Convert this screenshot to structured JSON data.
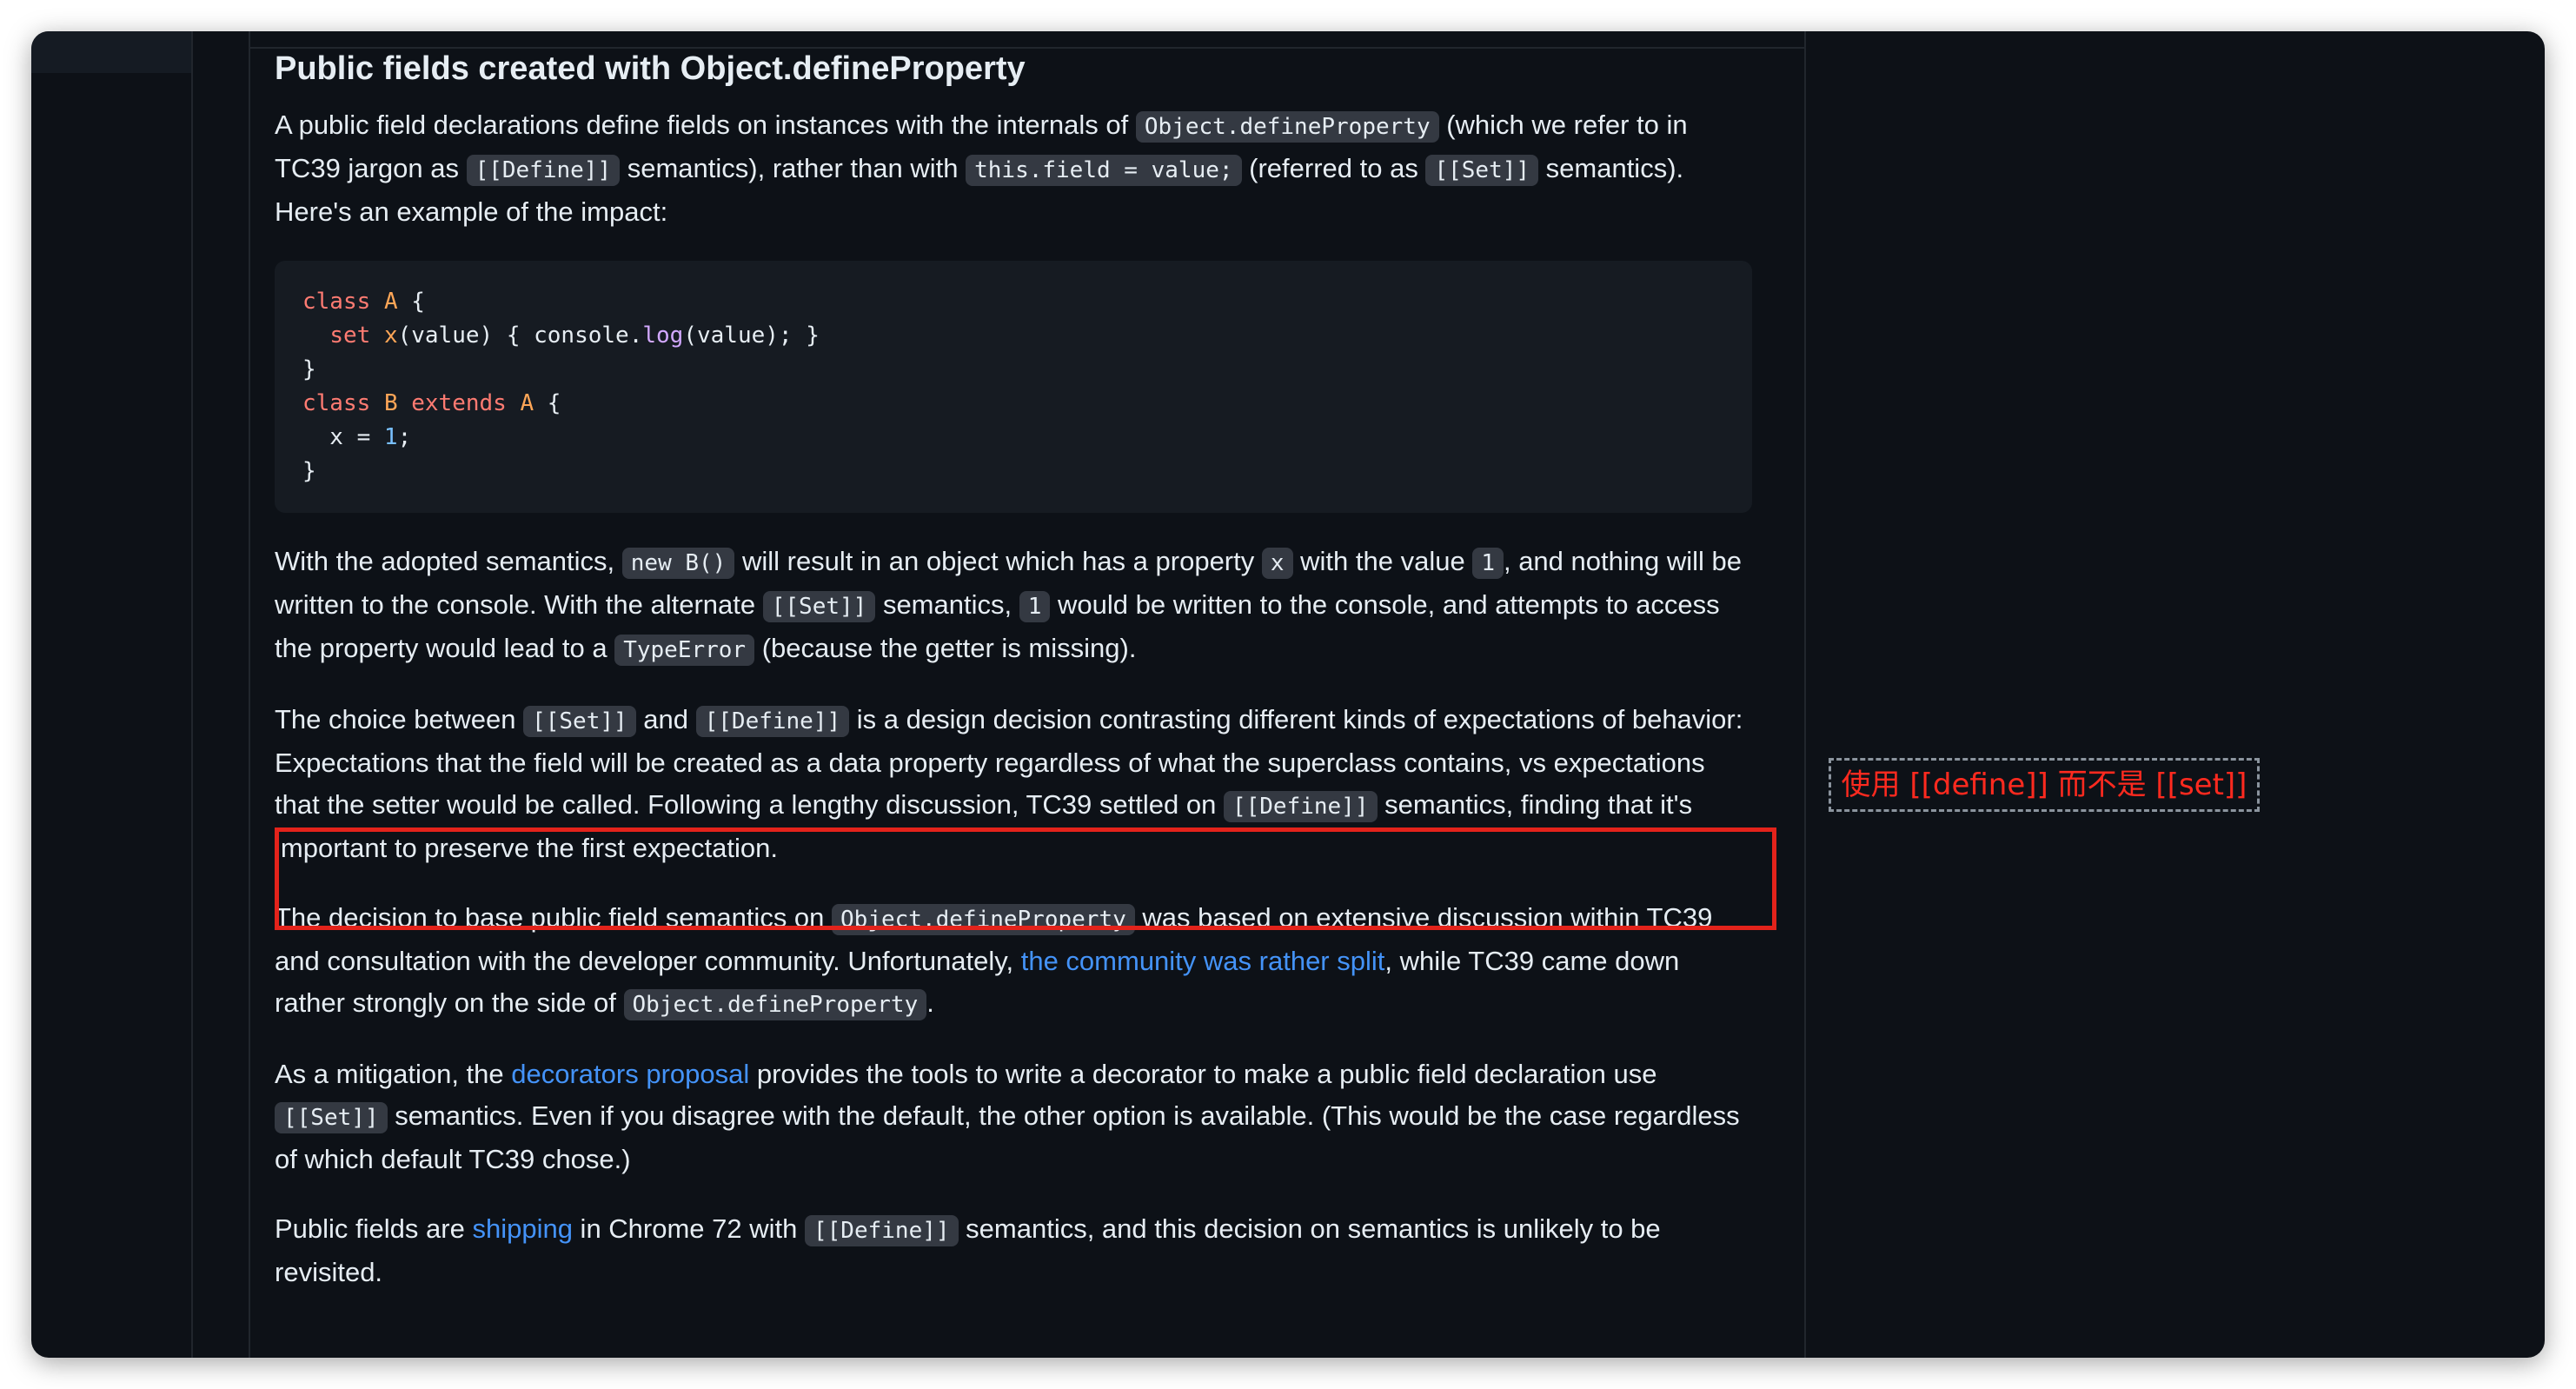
{
  "article": {
    "heading": "Public fields created with Object.defineProperty",
    "p1": {
      "t1": "A public field declarations define fields on instances with the internals of ",
      "c1": "Object.defineProperty",
      "t2": " (which we refer to in TC39 jargon as ",
      "c2": "[[Define]]",
      "t3": " semantics), rather than with ",
      "c3": "this.field = value;",
      "t4": " (referred to as ",
      "c4": "[[Set]]",
      "t5": " semantics). Here's an example of the impact:"
    },
    "code": {
      "l1": [
        "class",
        " ",
        "A",
        " {"
      ],
      "l2": [
        "  ",
        "set",
        " ",
        "x",
        "(value) { console.",
        "log",
        "(value); }"
      ],
      "l3": "}",
      "l4": [
        "class",
        " ",
        "B",
        " ",
        "extends",
        " ",
        "A",
        " {"
      ],
      "l5": [
        "  x = ",
        "1",
        ";"
      ],
      "l6": "}"
    },
    "p2": {
      "t1": "With the adopted semantics, ",
      "c1": "new B()",
      "t2": " will result in an object which has a property ",
      "c2": "x",
      "t3": " with the value ",
      "c3": "1",
      "t4": ", and nothing will be written to the console. With the alternate ",
      "c4": "[[Set]]",
      "t5": " semantics, ",
      "c5": "1",
      "t6": " would be written to the console, and attempts to access the property would lead to a ",
      "c6": "TypeError",
      "t7": " (because the getter is missing)."
    },
    "p3": {
      "t1": "The choice between ",
      "c1": "[[Set]]",
      "t2": " and ",
      "c2": "[[Define]]",
      "t3": " is a design decision contrasting different kinds of expectations of behavior: Expectations that the field will be created as a data property regardless of what the superclass contains, vs expectations that the setter would be called. Following a lengthy discussion, TC39 settled on ",
      "c3": "[[Define]]",
      "t4": " semantics, finding that it's important to preserve the first expectation."
    },
    "p4": {
      "t1": "The decision to base public field semantics on ",
      "c1": "Object.defineProperty",
      "t2": " was based on extensive discussion within TC39 and consultation with the developer community. Unfortunately, ",
      "link": "the community was rather split",
      "t3": ", while TC39 came down rather strongly on the side of ",
      "c2": "Object.defineProperty",
      "t4": "."
    },
    "p5": {
      "t1": "As a mitigation, the ",
      "link": "decorators proposal",
      "t2": " provides the tools to write a decorator to make a public field declaration use ",
      "c1": "[[Set]]",
      "t3": " semantics. Even if you disagree with the default, the other option is available. (This would be the case regardless of which default TC39 chose.)"
    },
    "p6": {
      "t1": "Public fields are ",
      "link": "shipping",
      "t2": " in Chrome 72 with ",
      "c1": "[[Define]]",
      "t3": " semantics, and this decision on semantics is unlikely to be revisited."
    }
  },
  "annotation": {
    "note": "使用 [[define]] 而不是 [[set]]",
    "box_color": "#e3231b",
    "text_color": "#ff2a1f"
  },
  "colors": {
    "background": "#0d1117",
    "text": "#e6edf3",
    "link": "#4493f8",
    "code_bg": "#161b22",
    "keyword": "#ff7b72",
    "function": "#d2a8ff",
    "type": "#ffa657",
    "number": "#79c0ff"
  }
}
